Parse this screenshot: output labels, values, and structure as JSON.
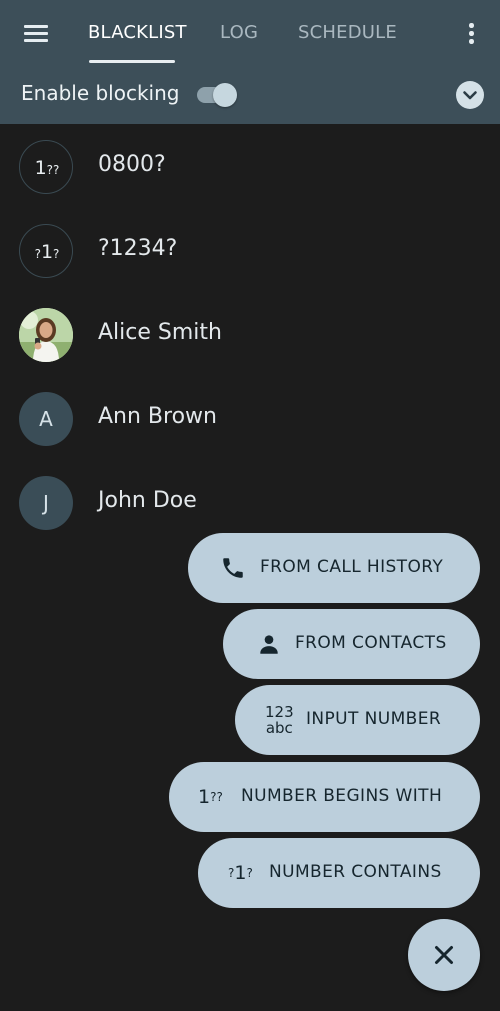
{
  "header": {
    "tabs": [
      {
        "label": "BLACKLIST",
        "active": true
      },
      {
        "label": "LOG",
        "active": false
      },
      {
        "label": "SCHEDULE",
        "active": false
      }
    ],
    "enable_blocking_label": "Enable blocking",
    "enable_blocking_on": true,
    "menu_icon": "hamburger-menu-icon",
    "more_icon": "more-vertical-icon",
    "collapse_icon": "chevron-down-icon"
  },
  "blacklist": [
    {
      "label": "0800?",
      "avatar_type": "begins-with",
      "avatar_big": "1",
      "avatar_small": "??"
    },
    {
      "label": "?1234?",
      "avatar_type": "contains",
      "avatar_big": "1",
      "avatar_small": "?"
    },
    {
      "label": "Alice Smith",
      "avatar_type": "photo"
    },
    {
      "label": "Ann Brown",
      "avatar_type": "letter",
      "avatar_letter": "A"
    },
    {
      "label": "John Doe",
      "avatar_type": "letter",
      "avatar_letter": "J"
    }
  ],
  "speed_dial": {
    "from_call_history": {
      "label": "FROM CALL HISTORY",
      "icon": "phone-icon"
    },
    "from_contacts": {
      "label": "FROM CONTACTS",
      "icon": "person-icon"
    },
    "input_number": {
      "label": "INPUT NUMBER",
      "icon_line1": "123",
      "icon_line2": "abc"
    },
    "number_begins_with": {
      "label": "NUMBER BEGINS WITH",
      "icon_big": "1",
      "icon_small": "??"
    },
    "number_contains": {
      "label": "NUMBER CONTAINS",
      "icon_small": "?",
      "icon_big": "1"
    },
    "close_icon": "close-icon"
  },
  "colors": {
    "header_bg": "#3d4f59",
    "body_bg": "#1c1c1c",
    "pill_bg": "#bccfdc",
    "avatar_bg": "#3a4d57"
  }
}
